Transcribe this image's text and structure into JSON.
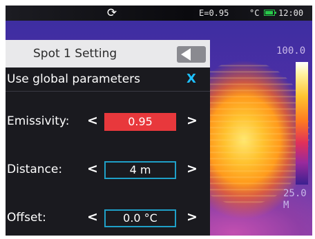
{
  "status": {
    "emissivity": "E=0.95",
    "unit": "°C",
    "time": "12:00"
  },
  "scale": {
    "max": "100.0",
    "min": "25.0",
    "min_suffix": "M"
  },
  "panel": {
    "title": "Spot 1 Setting",
    "global_label": "Use global parameters",
    "close_glyph": "X",
    "left_chevron": "<",
    "right_chevron": ">",
    "params": [
      {
        "label": "Emissivity:",
        "value": "0.95"
      },
      {
        "label": "Distance:",
        "value": "4 m"
      },
      {
        "label": "Offset:",
        "value": "0.0 °C"
      }
    ]
  },
  "colors": {
    "accent": "#1ec0ff",
    "active_value": "#e8383c",
    "battery": "#28c84a"
  },
  "icons": [
    "refresh-icon",
    "battery-icon",
    "back-arrow-icon",
    "close-icon"
  ]
}
